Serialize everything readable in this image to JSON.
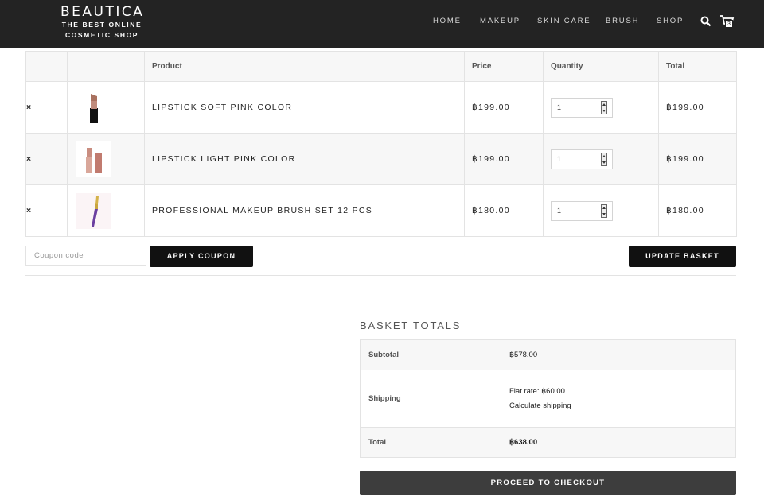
{
  "brand": {
    "name": "BEAUTICA",
    "tagline_1": "THE BEST ONLINE",
    "tagline_2": "COSMETIC SHOP"
  },
  "nav": {
    "items": [
      "HOME",
      "MAKEUP",
      "SKIN CARE",
      "BRUSH",
      "SHOP"
    ]
  },
  "header_icons": {
    "search": "search-icon",
    "cart": "cart-icon",
    "cart_count": "3"
  },
  "cart": {
    "headers": {
      "remove": "",
      "thumbnail": "",
      "product": "Product",
      "price": "Price",
      "quantity": "Quantity",
      "total": "Total"
    },
    "remove_glyph": "×",
    "items": [
      {
        "name": "LIPSTICK SOFT PINK COLOR",
        "price": "฿199.00",
        "quantity": "1",
        "total": "฿199.00"
      },
      {
        "name": "LIPSTICK LIGHT PINK COLOR",
        "price": "฿199.00",
        "quantity": "1",
        "total": "฿199.00"
      },
      {
        "name": "PROFESSIONAL MAKEUP BRUSH SET 12 PCS",
        "price": "฿180.00",
        "quantity": "1",
        "total": "฿180.00"
      }
    ],
    "coupon_placeholder": "Coupon code",
    "apply_coupon_label": "APPLY COUPON",
    "update_basket_label": "UPDATE BASKET"
  },
  "totals": {
    "title": "BASKET TOTALS",
    "subtotal_label": "Subtotal",
    "subtotal_value": "฿578.00",
    "shipping_label": "Shipping",
    "shipping_rate_label": "Flat rate: ",
    "shipping_rate_value": "฿60.00",
    "calculate_shipping": "Calculate shipping",
    "total_label": "Total",
    "total_value": "฿638.00",
    "checkout_label": "PROCEED TO CHECKOUT"
  },
  "colors": {
    "header_bg": "#232323",
    "remove_red": "#e2401c",
    "button_dark": "#111111",
    "checkout_bg": "#3d3d3d"
  }
}
